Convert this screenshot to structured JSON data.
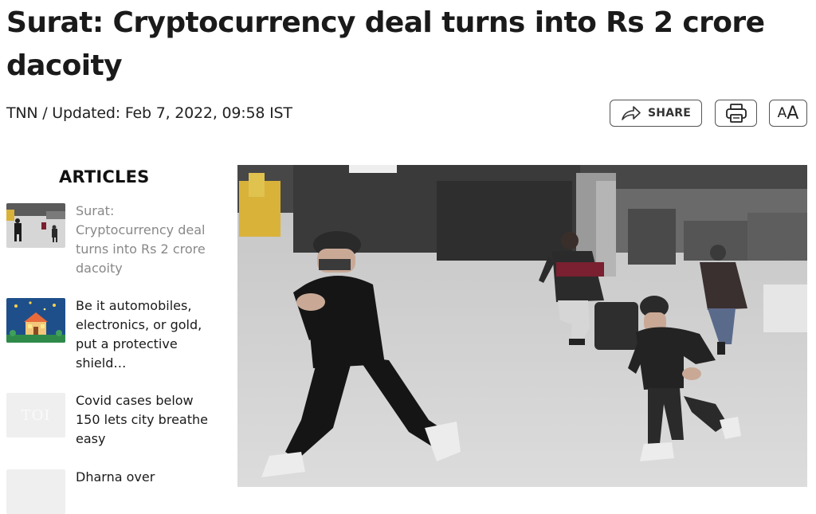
{
  "article": {
    "headline": "Surat: Cryptocurrency deal turns into Rs 2 crore dacoity",
    "byline": "TNN / Updated: Feb 7, 2022, 09:58 IST"
  },
  "toolbar": {
    "share_label": "SHARE",
    "share_icon": "share-arrow-icon",
    "print_icon": "printer-icon",
    "font_size_small": "A",
    "font_size_large": "A"
  },
  "sidebar": {
    "title": "ARTICLES",
    "items": [
      {
        "label": "Surat: Cryptocurrency deal turns into Rs 2 crore dacoity",
        "active": true,
        "thumb": "cctv-thumbnail"
      },
      {
        "label": "Be it automobiles, electronics, or gold, put a protective shield…",
        "active": false,
        "thumb": "festive-house-thumbnail"
      },
      {
        "label": "Covid cases below 150 lets city breathe easy",
        "active": false,
        "thumb": "toi-placeholder",
        "thumb_text": "TOI"
      },
      {
        "label": "Dharna over",
        "active": false,
        "thumb": "toi-placeholder"
      }
    ]
  },
  "hero": {
    "image": "cctv-footage-men-running"
  },
  "colors": {
    "text": "#1a1a1a",
    "muted": "#888888",
    "border": "#555555"
  }
}
